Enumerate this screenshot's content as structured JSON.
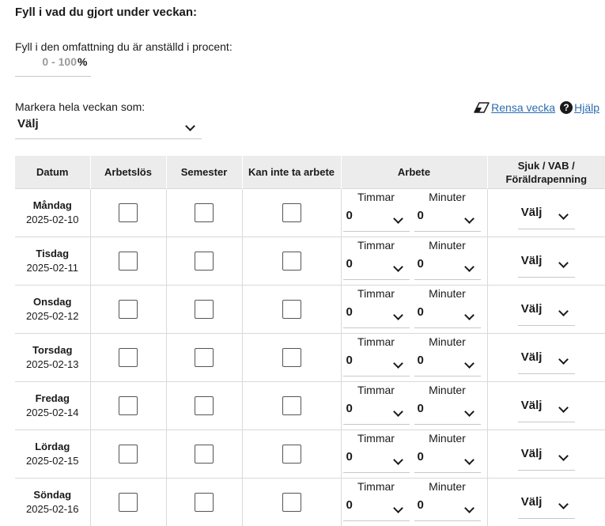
{
  "heading": "Fyll i vad du gjort under veckan:",
  "percent": {
    "label": "Fyll i den omfattning du är anställd i procent:",
    "placeholder": "0 - 100",
    "unit": "%"
  },
  "week_mark": {
    "label": "Markera hela veckan som:",
    "value": "Välj"
  },
  "actions": {
    "clear_label": "Rensa vecka",
    "clear_icon": "eraser-icon",
    "help_label": "Hjälp",
    "help_icon": "question-circle-icon",
    "help_glyph": "?"
  },
  "table": {
    "headers": {
      "date": "Datum",
      "unemployed": "Arbetslös",
      "vacation": "Semester",
      "cannot_work": "Kan inte ta arbete",
      "work": "Arbete",
      "sick_line1": "Sjuk / VAB /",
      "sick_line2": "Föräldrapenning"
    },
    "hours_label": "Timmar",
    "minutes_label": "Minuter",
    "days": [
      {
        "name": "Måndag",
        "date": "2025-02-10",
        "hours": "0",
        "minutes": "0",
        "sick": "Välj"
      },
      {
        "name": "Tisdag",
        "date": "2025-02-11",
        "hours": "0",
        "minutes": "0",
        "sick": "Välj"
      },
      {
        "name": "Onsdag",
        "date": "2025-02-12",
        "hours": "0",
        "minutes": "0",
        "sick": "Välj"
      },
      {
        "name": "Torsdag",
        "date": "2025-02-13",
        "hours": "0",
        "minutes": "0",
        "sick": "Välj"
      },
      {
        "name": "Fredag",
        "date": "2025-02-14",
        "hours": "0",
        "minutes": "0",
        "sick": "Välj"
      },
      {
        "name": "Lördag",
        "date": "2025-02-15",
        "hours": "0",
        "minutes": "0",
        "sick": "Välj"
      },
      {
        "name": "Söndag",
        "date": "2025-02-16",
        "hours": "0",
        "minutes": "0",
        "sick": "Välj"
      }
    ]
  },
  "colors": {
    "link": "#2b6cb0",
    "header_bg": "#ececec",
    "border": "#d9d9d9",
    "placeholder": "#9a9a9a"
  }
}
